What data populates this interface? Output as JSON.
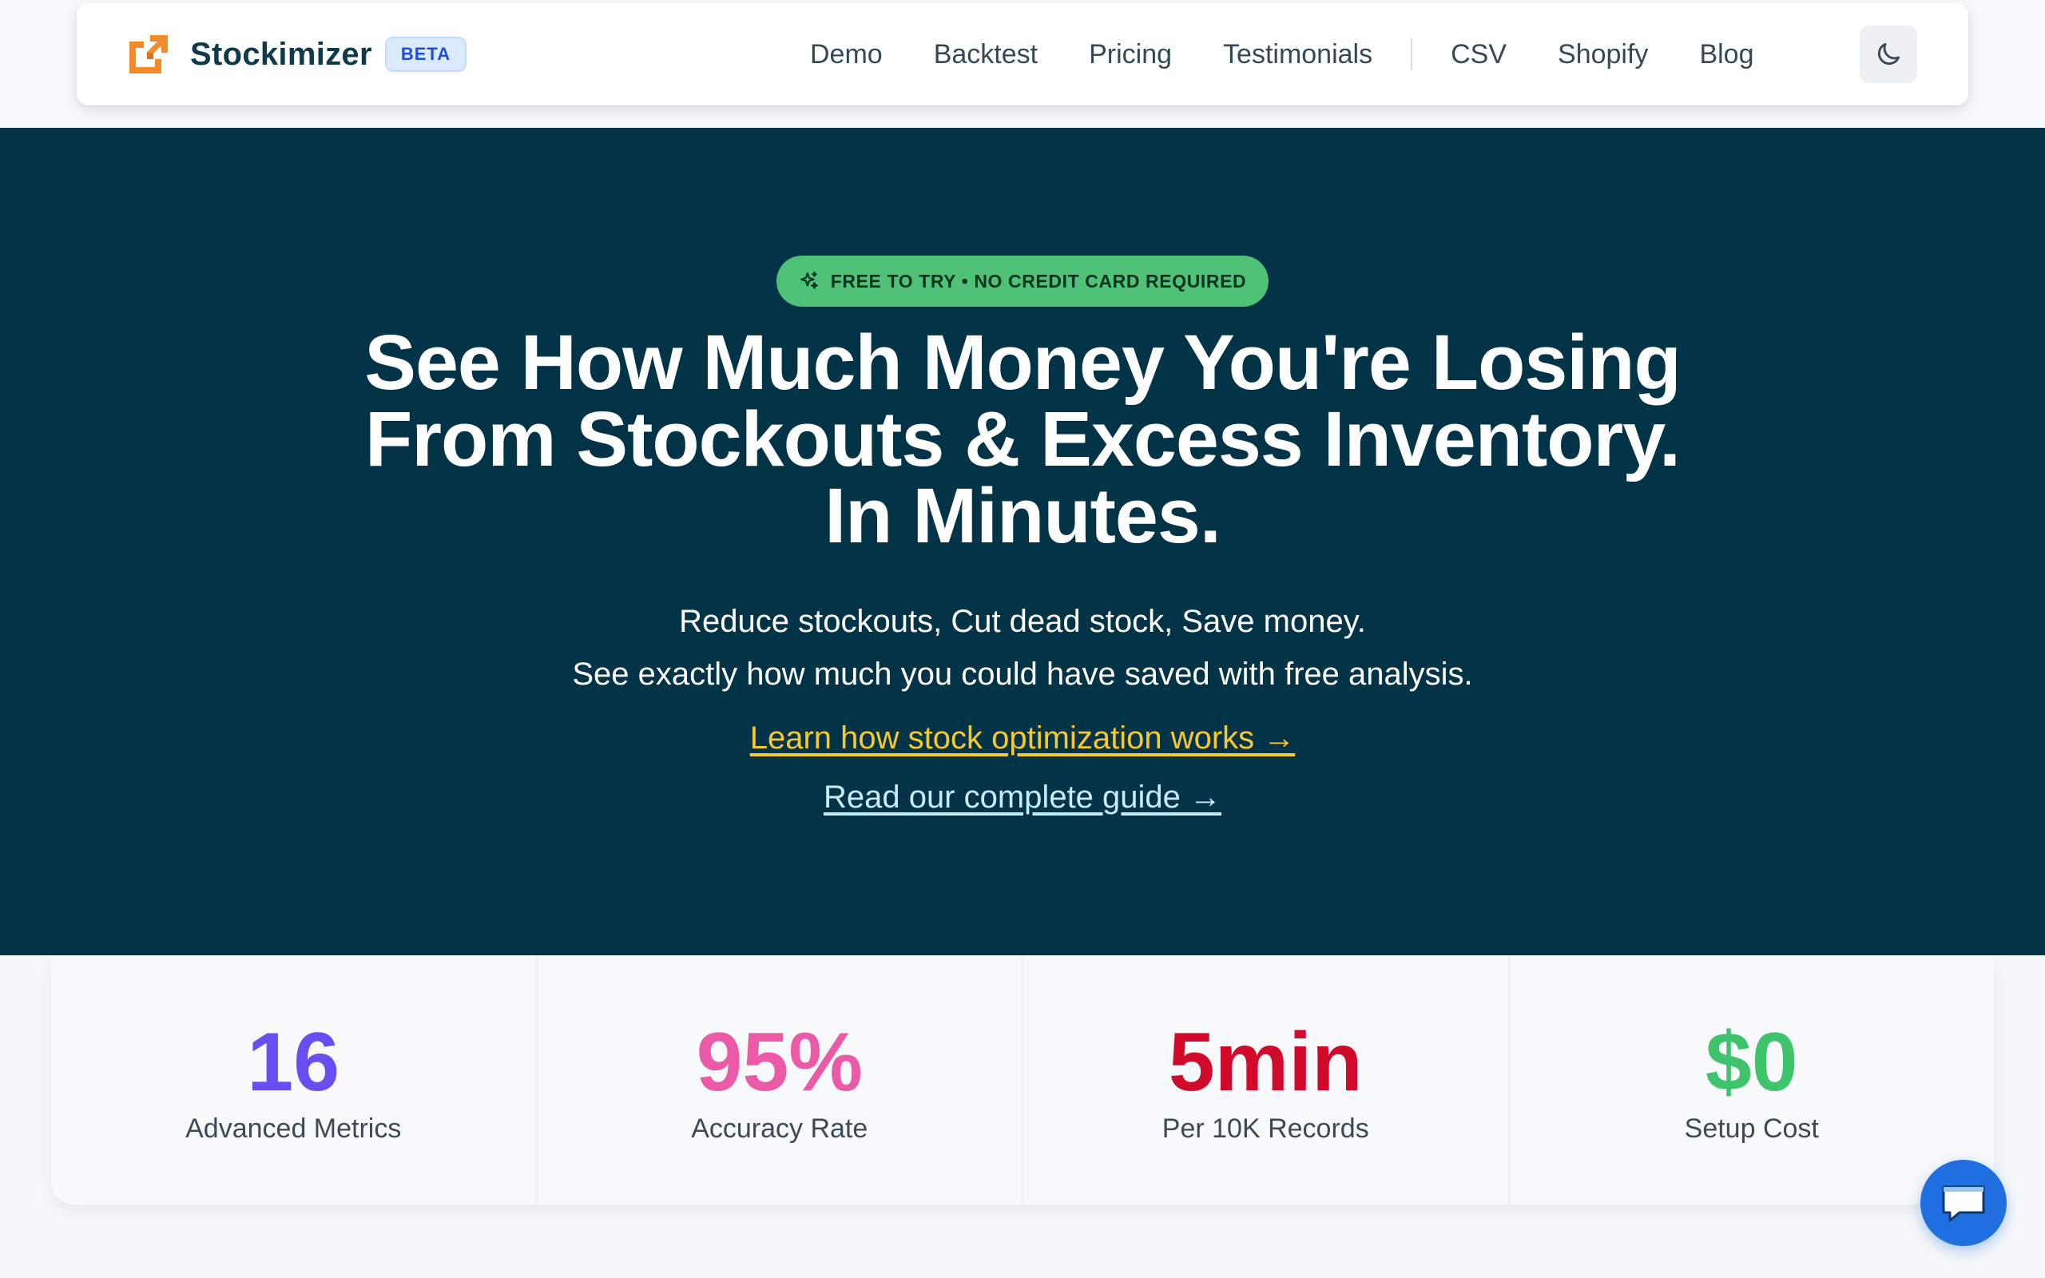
{
  "brand": {
    "name": "Stockimizer",
    "badge": "BETA",
    "logo_icon": "stockimizer-logo",
    "accent": "#f28c28"
  },
  "nav": {
    "links": [
      "Demo",
      "Backtest",
      "Pricing",
      "Testimonials"
    ],
    "links_secondary": [
      "CSV",
      "Shopify",
      "Blog"
    ],
    "theme_toggle_icon": "moon-icon"
  },
  "hero": {
    "badge": "FREE TO TRY • NO CREDIT CARD REQUIRED",
    "badge_icon": "sparkles-icon",
    "headline_lines": [
      "See How Much Money You're Losing",
      "From Stockouts & Excess Inventory.",
      "In Minutes."
    ],
    "subtitle_lines": [
      "Reduce stockouts, Cut dead stock, Save money.",
      "See exactly how much you could have saved with free analysis."
    ],
    "link_primary": "Learn how stock optimization works →",
    "link_secondary": "Read our complete guide →",
    "colors": {
      "background": "#033346",
      "link_primary": "#f7c931",
      "link_secondary": "#c8ecf7",
      "badge": "#4fc277"
    }
  },
  "stats": [
    {
      "value": "16",
      "label": "Advanced Metrics",
      "color": "#6a4df0"
    },
    {
      "value": "95%",
      "label": "Accuracy Rate",
      "color": "#ea5aa6"
    },
    {
      "value": "5min",
      "label": "Per 10K Records",
      "color": "#d10a2b"
    },
    {
      "value": "$0",
      "label": "Setup Cost",
      "color": "#3fc46d"
    }
  ],
  "chat_widget": {
    "icon": "chat-bubble-icon"
  }
}
